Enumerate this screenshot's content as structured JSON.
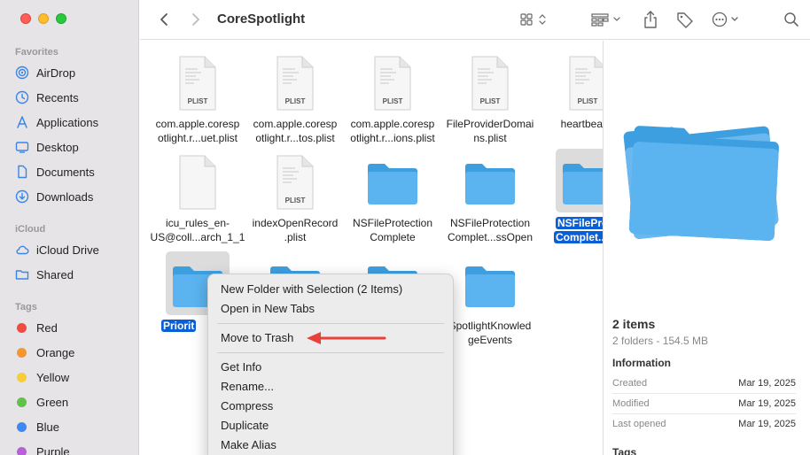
{
  "window": {
    "title": "CoreSpotlight"
  },
  "sidebar": {
    "favorites_label": "Favorites",
    "favorites": [
      {
        "label": "AirDrop",
        "icon": "airdrop-icon"
      },
      {
        "label": "Recents",
        "icon": "clock-icon"
      },
      {
        "label": "Applications",
        "icon": "applications-icon"
      },
      {
        "label": "Desktop",
        "icon": "desktop-icon"
      },
      {
        "label": "Documents",
        "icon": "document-icon"
      },
      {
        "label": "Downloads",
        "icon": "download-icon"
      }
    ],
    "icloud_label": "iCloud",
    "icloud": [
      {
        "label": "iCloud Drive",
        "icon": "cloud-icon"
      },
      {
        "label": "Shared",
        "icon": "shared-folder-icon"
      }
    ],
    "tags_label": "Tags",
    "tags": [
      {
        "label": "Red",
        "color": "#f24a3e"
      },
      {
        "label": "Orange",
        "color": "#f6962e"
      },
      {
        "label": "Yellow",
        "color": "#f8cd38"
      },
      {
        "label": "Green",
        "color": "#5ec348"
      },
      {
        "label": "Blue",
        "color": "#3c88f5"
      },
      {
        "label": "Purple",
        "color": "#b860d8"
      }
    ]
  },
  "files": [
    {
      "name": "com.apple.corespotlight.r...uet.plist",
      "line1": "com.apple.coresp",
      "line2": "otlight.r...uet.plist",
      "type": "plist",
      "badge": "PLIST"
    },
    {
      "name": "com.apple.corespotlight.r...tos.plist",
      "line1": "com.apple.coresp",
      "line2": "otlight.r...tos.plist",
      "type": "plist",
      "badge": "PLIST"
    },
    {
      "name": "com.apple.corespotlight.r...ions.plist",
      "line1": "com.apple.coresp",
      "line2": "otlight.r...ions.plist",
      "type": "plist",
      "badge": "PLIST"
    },
    {
      "name": "FileProviderDomains.plist",
      "line1": "FileProviderDomai",
      "line2": "ns.plist",
      "type": "plist",
      "badge": "PLIST"
    },
    {
      "name": "heartbeat.p",
      "line1": "heartbeat.p",
      "line2": "",
      "type": "plist",
      "badge": "PLIST"
    },
    {
      "name": "icu_rules_en-US@coll...arch_1_1",
      "line1": "icu_rules_en-",
      "line2": "US@coll...arch_1_1",
      "type": "doc",
      "badge": ""
    },
    {
      "name": "indexOpenRecord.plist",
      "line1": "indexOpenRecord",
      "line2": ".plist",
      "type": "plist",
      "badge": "PLIST"
    },
    {
      "name": "NSFileProtectionComplete",
      "line1": "NSFileProtection",
      "line2": "Complete",
      "type": "folder",
      "badge": ""
    },
    {
      "name": "NSFileProtectionComplet...ssOpen",
      "line1": "NSFileProtection",
      "line2": "Complet...ssOpen",
      "type": "folder",
      "badge": ""
    },
    {
      "name": "NSFileProteComplet...tic",
      "line1": "NSFileProte",
      "line2": "Complet...tic",
      "type": "folder",
      "badge": "",
      "selected": true
    },
    {
      "name": "Priorit",
      "line1": "Priorit",
      "line2": "",
      "type": "folder",
      "badge": "",
      "selected": true
    },
    {
      "name": "",
      "line1": "",
      "line2": "",
      "type": "folder",
      "badge": ""
    },
    {
      "name": "",
      "line1": "",
      "line2": "",
      "type": "folder",
      "badge": ""
    },
    {
      "name": "SpotlightKnowledgeEvents",
      "line1": "SpotlightKnowled",
      "line2": "geEvents",
      "type": "folder",
      "badge": ""
    }
  ],
  "preview": {
    "title": "2 items",
    "subtitle": "2 folders - 154.5 MB",
    "info_heading": "Information",
    "rows": [
      {
        "label": "Created",
        "value": "Mar 19, 2025"
      },
      {
        "label": "Modified",
        "value": "Mar 19, 2025"
      },
      {
        "label": "Last opened",
        "value": "Mar 19, 2025"
      }
    ],
    "tags_heading": "Tags"
  },
  "context_menu": {
    "items": [
      "New Folder with Selection (2 Items)",
      "Open in New Tabs",
      "Move to Trash",
      "Get Info",
      "Rename...",
      "Compress",
      "Duplicate",
      "Make Alias"
    ],
    "highlight_color": "#e8413a"
  },
  "colors": {
    "accent": "#0a5fd6",
    "folder": "#5bb4f0"
  }
}
